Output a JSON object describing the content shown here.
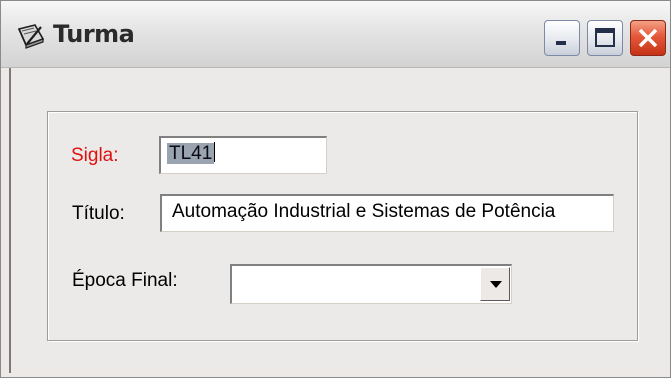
{
  "window": {
    "title": "Turma",
    "icon": "notebook-pencil-icon",
    "controls": [
      "minimize-icon",
      "maximize-icon",
      "close-icon"
    ],
    "close_color": "#d94a2a"
  },
  "form": {
    "sigla": {
      "label": "Sigla:",
      "value": "TL41",
      "label_color": "#e01010"
    },
    "titulo": {
      "label": "Título:",
      "value": "Automação Industrial e Sistemas de Potência"
    },
    "epoca_final": {
      "label": "Época Final:",
      "value": "",
      "dropdown_icon": "chevron-down-icon"
    }
  }
}
